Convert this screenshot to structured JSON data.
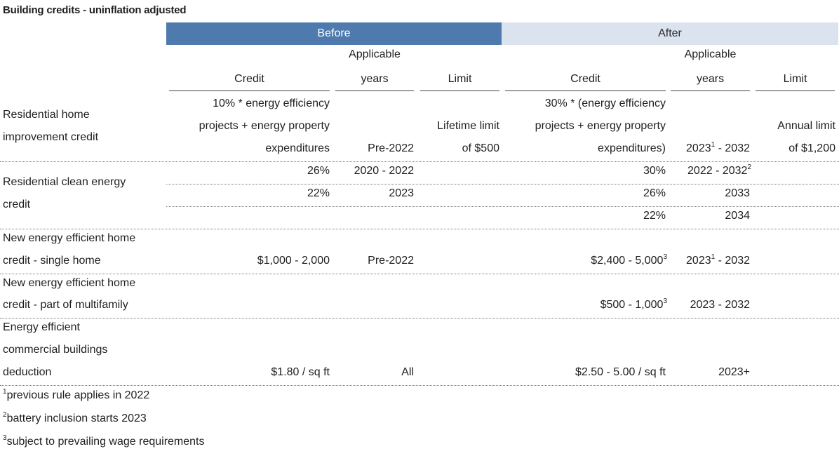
{
  "title": "Building credits - uninflation adjusted",
  "bands": {
    "before": "Before",
    "after": "After"
  },
  "headers": {
    "credit": "Credit",
    "applicable_line1": "Applicable",
    "applicable_line2": "years",
    "limit": "Limit"
  },
  "rows": {
    "home_improvement": {
      "label_l1": "Residential home",
      "label_l2": "improvement credit",
      "before_credit_l1": "10% * energy efficiency",
      "before_credit_l2": "projects + energy property",
      "before_credit_l3": "expenditures",
      "before_years": "Pre-2022",
      "before_limit_l1": "Lifetime limit",
      "before_limit_l2": "of $500",
      "after_credit_l1": "30% * (energy efficiency",
      "after_credit_l2": "projects + energy property",
      "after_credit_l3": "expenditures)",
      "after_years_a": "2023",
      "after_years_sup": "1",
      "after_years_b": " - 2032",
      "after_limit_l1": "Annual limit",
      "after_limit_l2": "of $1,200"
    },
    "clean_energy": {
      "label_l1": "Residential clean energy",
      "label_l2": "credit",
      "r1_before_credit": "26%",
      "r1_before_years": "2020 - 2022",
      "r1_after_credit": "30%",
      "r1_after_years": "2022 - 2032",
      "r1_after_years_sup": "2",
      "r2_before_credit": "22%",
      "r2_before_years": "2023",
      "r2_after_credit": "26%",
      "r2_after_years": "2033",
      "r3_after_credit": "22%",
      "r3_after_years": "2034"
    },
    "single_home": {
      "label_l1": "New energy efficient home",
      "label_l2": "credit - single home",
      "before_credit": "$1,000 - 2,000",
      "before_years": "Pre-2022",
      "after_credit": "$2,400 - 5,000",
      "after_credit_sup": "3",
      "after_years_a": "2023",
      "after_years_sup": "1",
      "after_years_b": " - 2032"
    },
    "multifamily": {
      "label_l1": "New energy efficient home",
      "label_l2": "credit - part of multifamily",
      "after_credit": "$500 - 1,000",
      "after_credit_sup": "3",
      "after_years": "2023 - 2032"
    },
    "commercial": {
      "label_l1": "Energy efficient",
      "label_l2": "commercial buildings",
      "label_l3": "deduction",
      "before_credit": "$1.80 / sq ft",
      "before_years": "All",
      "after_credit": "$2.50 - 5.00 / sq ft",
      "after_years": "2023+"
    }
  },
  "footnotes": [
    {
      "mark": "1",
      "text": "previous rule applies in 2022"
    },
    {
      "mark": "2",
      "text": "battery inclusion starts 2023"
    },
    {
      "mark": "3",
      "text": "subject to prevailing wage requirements"
    }
  ]
}
